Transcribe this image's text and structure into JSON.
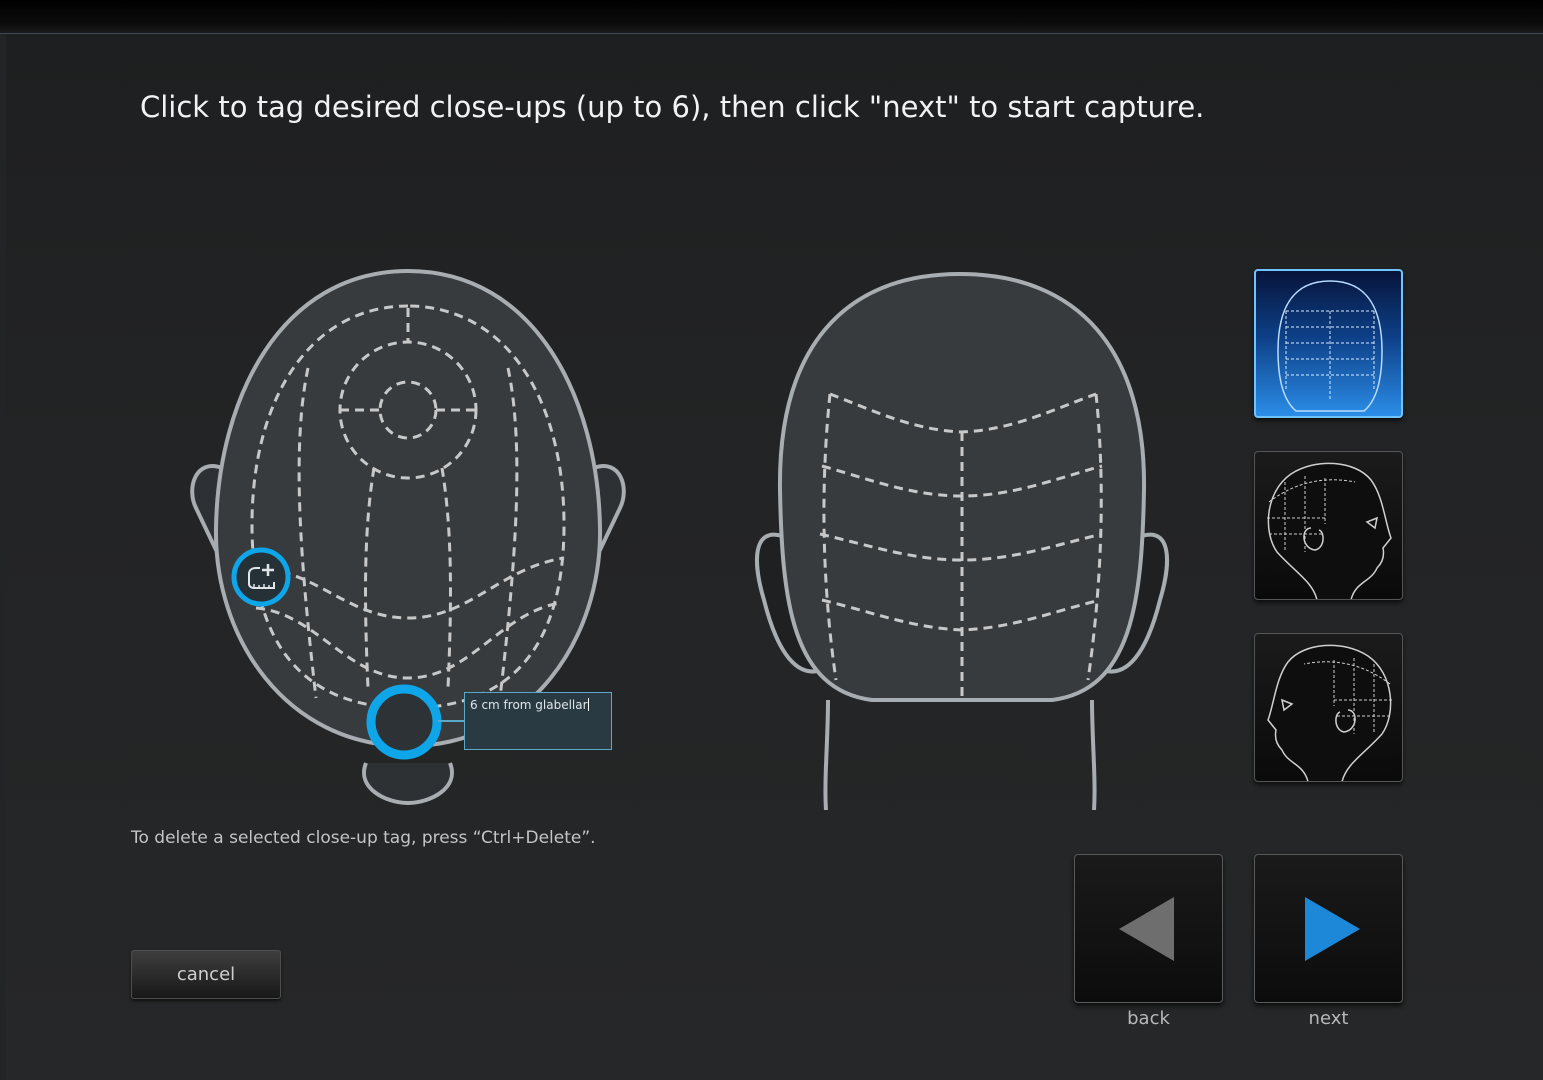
{
  "instruction": "Click to tag desired close-ups (up to 6), then click \"next\" to start capture.",
  "delete_hint": "To delete a selected close-up tag, press “Ctrl+Delete”.",
  "tag": {
    "label_text": "6 cm from glabellar"
  },
  "buttons": {
    "cancel": "cancel",
    "back": "back",
    "next": "next"
  },
  "views": [
    {
      "name": "back-view",
      "selected": true
    },
    {
      "name": "right-side-view",
      "selected": false
    },
    {
      "name": "left-side-view",
      "selected": false
    }
  ],
  "colors": {
    "accent": "#0ea5e9",
    "selected_view": "#2b8de8",
    "next_arrow": "#1e88d8",
    "back_arrow": "#6e6e6e"
  },
  "icons": {
    "tag_tool": "ruler-plus-icon",
    "back": "triangle-left-icon",
    "next": "triangle-right-icon"
  }
}
